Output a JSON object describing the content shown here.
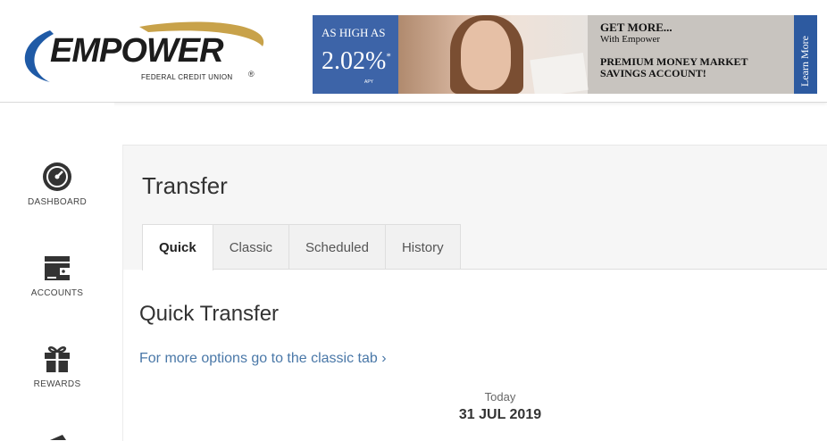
{
  "header": {
    "logo": {
      "word": "EMPOWER",
      "subtitle": "FEDERAL CREDIT UNION",
      "registered": "®"
    },
    "banner": {
      "as_high_as": "AS HIGH AS",
      "rate": "2.02%",
      "rate_mark": "*",
      "apy": "APY",
      "headline": "GET MORE...",
      "subline": "With Empower",
      "product_line1": "PREMIUM MONEY MARKET",
      "product_line2": "SAVINGS ACCOUNT!",
      "learn_more": "Learn More",
      "colors": {
        "blue_panel": "#3d64a8",
        "learn_tab": "#2d5aa0"
      }
    }
  },
  "sidebar": {
    "items": [
      {
        "label": "DASHBOARD",
        "icon": "gauge-icon"
      },
      {
        "label": "ACCOUNTS",
        "icon": "wallet-icon"
      },
      {
        "label": "REWARDS",
        "icon": "gift-icon"
      }
    ]
  },
  "main": {
    "title": "Transfer",
    "tabs": [
      {
        "label": "Quick",
        "active": true
      },
      {
        "label": "Classic",
        "active": false
      },
      {
        "label": "Scheduled",
        "active": false
      },
      {
        "label": "History",
        "active": false
      }
    ],
    "quick_transfer": {
      "title": "Quick Transfer",
      "classic_link": "For more options go to the classic tab ›",
      "date_label": "Today",
      "date_value": "31 JUL 2019"
    }
  },
  "colors": {
    "link": "#4a78a8",
    "logo_blue": "#1f5aa6",
    "logo_gold": "#c8a24a"
  }
}
